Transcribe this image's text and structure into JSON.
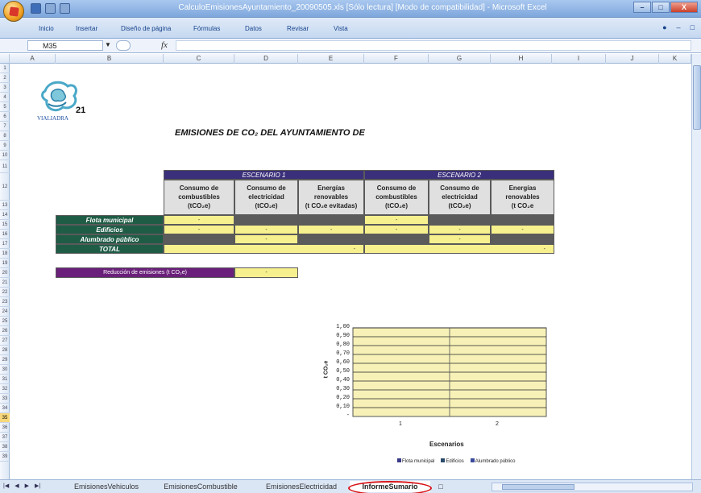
{
  "window": {
    "title": "CalculoEmisionesAyuntamiento_20090505.xls [Sólo lectura] [Modo de compatibilidad] - Microsoft Excel"
  },
  "ribbon": {
    "tabs": [
      "Inicio",
      "Insertar",
      "Diseño de página",
      "Fórmulas",
      "Datos",
      "Revisar",
      "Vista"
    ]
  },
  "formula_bar": {
    "name_box": "M35",
    "fx": "fx",
    "value": ""
  },
  "columns": [
    "A",
    "B",
    "C",
    "D",
    "E",
    "F",
    "G",
    "H",
    "I",
    "J",
    "K"
  ],
  "rows": [
    "1",
    "2",
    "3",
    "4",
    "5",
    "6",
    "7",
    "8",
    "9",
    "10",
    "11",
    "12",
    "13",
    "14",
    "15",
    "16",
    "17",
    "18",
    "19",
    "20",
    "21",
    "22",
    "23",
    "24",
    "25",
    "26",
    "27",
    "28",
    "29",
    "30",
    "31",
    "32",
    "33",
    "34",
    "35",
    "36",
    "37",
    "38",
    "39"
  ],
  "selected_row": "35",
  "logo": {
    "text": "21",
    "caption": "VIALIADRA"
  },
  "sheet_title": "EMISIONES DE CO₂ DEL AYUNTAMIENTO DE",
  "table": {
    "scenario_1": "ESCENARIO 1",
    "scenario_2": "ESCENARIO 2",
    "sub_headers": [
      {
        "l1": "Consumo de",
        "l2": "combustibles",
        "l3": "(tCO₂e)"
      },
      {
        "l1": "Consumo de",
        "l2": "electricidad",
        "l3": "(tCO₂e)"
      },
      {
        "l1": "Energías",
        "l2": "renovables",
        "l3": "(t CO₂e evitadas)"
      },
      {
        "l1": "Consumo de",
        "l2": "combustibles",
        "l3": "(tCO₂e)"
      },
      {
        "l1": "Consumo de",
        "l2": "electricidad",
        "l3": "(tCO₂e)"
      },
      {
        "l1": "Energías",
        "l2": "renovables",
        "l3": "(t CO₂e"
      }
    ],
    "row_labels": [
      "Flota municipal",
      "Edificios",
      "Alumbrado público",
      "TOTAL"
    ],
    "dash": "-"
  },
  "reduction": {
    "label": "Reducción de emisiones (t CO₂e)",
    "value": "-"
  },
  "chart_data": {
    "type": "bar",
    "categories": [
      "1",
      "2"
    ],
    "series": [
      {
        "name": "Flota municipal",
        "values": [
          0,
          0
        ],
        "color": "#3a3a8a"
      },
      {
        "name": "Edificios",
        "values": [
          0,
          0
        ],
        "color": "#2a4a6a"
      },
      {
        "name": "Alumbrado público",
        "values": [
          0,
          0
        ],
        "color": "#3a4a9a"
      }
    ],
    "yticks": [
      "1,00",
      "0,90",
      "0,80",
      "0,70",
      "0,60",
      "0,50",
      "0,40",
      "0,30",
      "0,20",
      "0,10",
      "-"
    ],
    "ylim": [
      0,
      1
    ],
    "xlabel": "Escenarios",
    "ylabel": "t CO₂e",
    "legend_position": "bottom"
  },
  "sheet_tabs": [
    "EmisionesVehiculos",
    "EmisionesCombustible",
    "EmisionesElectricidad",
    "InformeSumario"
  ],
  "active_tab": "InformeSumario"
}
